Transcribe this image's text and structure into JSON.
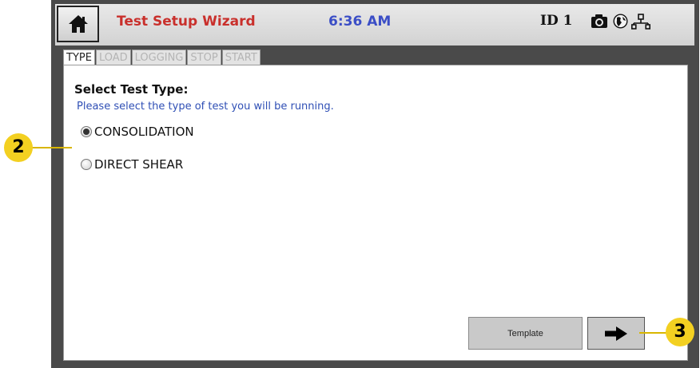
{
  "header": {
    "title": "Test Setup Wizard",
    "time": "6:36 AM",
    "device_id": "ID 1",
    "icons": [
      "home-icon",
      "camera-icon",
      "globe-icon",
      "network-icon"
    ]
  },
  "tabs": [
    {
      "label": "TYPE",
      "active": true
    },
    {
      "label": "LOAD",
      "active": false
    },
    {
      "label": "LOGGING",
      "active": false
    },
    {
      "label": "STOP",
      "active": false
    },
    {
      "label": "START",
      "active": false
    }
  ],
  "main": {
    "heading": "Select Test Type:",
    "subtext": "Please select the type of test you will be running.",
    "options": [
      {
        "label": "CONSOLIDATION",
        "selected": true
      },
      {
        "label": "DIRECT SHEAR",
        "selected": false
      }
    ],
    "template_button": "Template",
    "next_button_icon": "arrow-right-icon"
  },
  "callouts": [
    "2",
    "3"
  ],
  "colors": {
    "title": "#c9302c",
    "time": "#3b4ec6",
    "subtext": "#2f4fb5",
    "callout": "#f3d021",
    "frame": "#4a4a4a"
  }
}
